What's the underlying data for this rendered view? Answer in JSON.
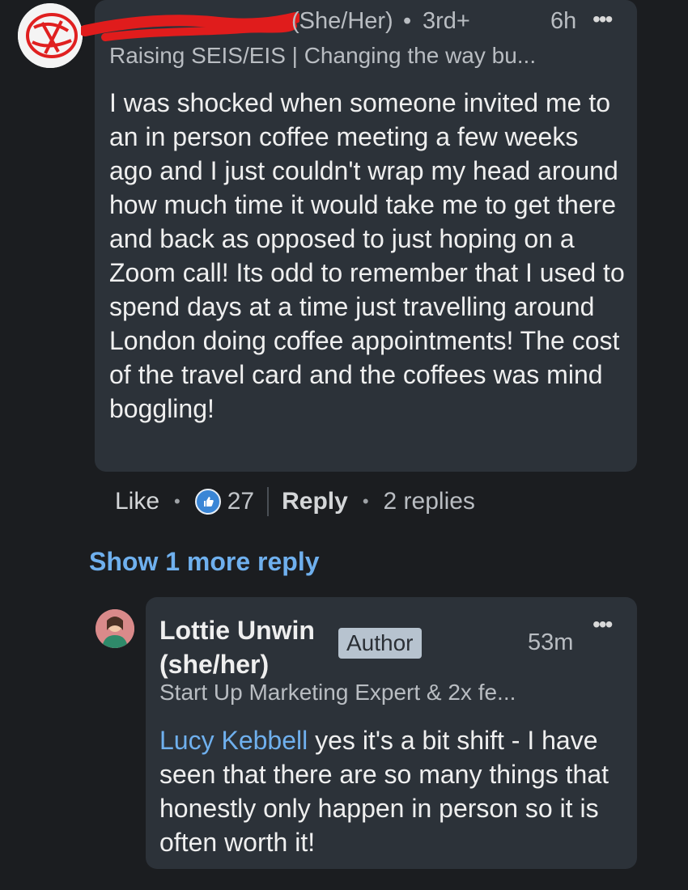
{
  "comment": {
    "pronouns": "(She/Her)",
    "connection_degree": "3rd+",
    "time": "6h",
    "more_label": "•••",
    "headline": "Raising SEIS/EIS | Changing the way bu...",
    "text": "I was shocked when someone invited me to an in person coffee meeting a few weeks ago and I just couldn't wrap my head around how much time it would take me to get there and back as opposed to just hoping on a Zoom call! Its odd to remember that I used to spend days at a time just travelling around London doing coffee appointments! The cost of the travel card and the coffees was mind boggling!",
    "actions": {
      "like_label": "Like",
      "reaction_count": "27",
      "reply_label": "Reply",
      "replies_label": "2 replies"
    }
  },
  "show_more_label": "Show 1 more reply",
  "reply": {
    "name": "Lottie Unwin (she/her)",
    "badge": "Author",
    "time": "53m",
    "more_label": "•••",
    "headline": "Start Up Marketing Expert & 2x fe...",
    "mention": "Lucy Kebbell",
    "text": " yes it's a bit shift - I have seen that there are so many things that honestly only happen in person so it is often worth it!"
  },
  "colors": {
    "background": "#1b1d20",
    "bubble": "#2c3239",
    "link": "#6fb0ee",
    "reaction": "#3a86d6"
  },
  "icons": {
    "avatar1": "redacted-avatar",
    "avatar2": "profile-photo",
    "reaction": "thumbs-up-icon",
    "more": "more-options-icon"
  }
}
